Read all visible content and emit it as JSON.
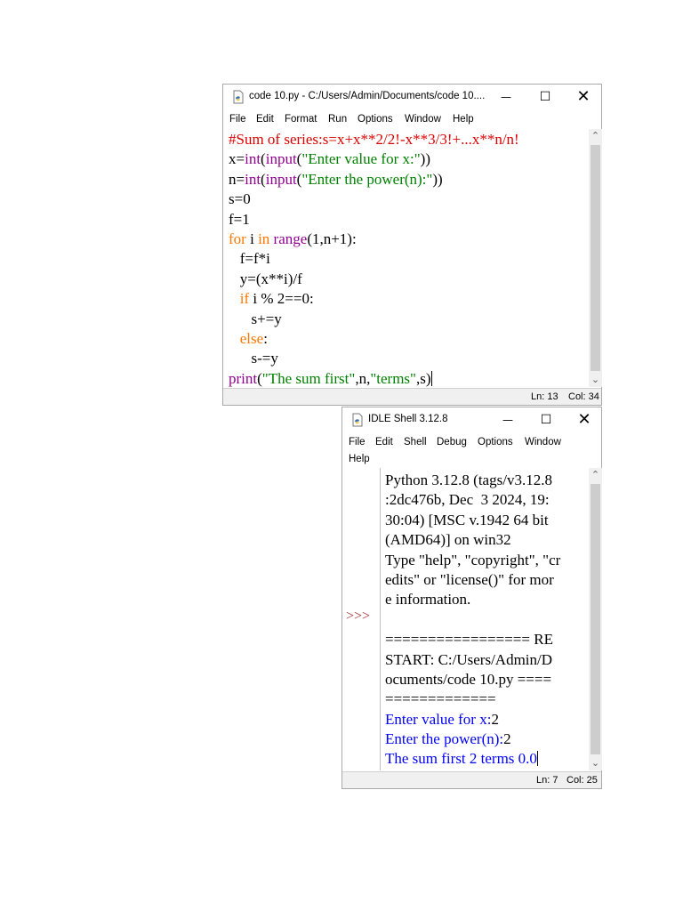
{
  "colors": {
    "comment": "#dd0000",
    "builtin": "#900090",
    "string": "#008000",
    "keyword": "#ff7700",
    "output": "#0000ff",
    "prompt": "#a52a2a"
  },
  "editor": {
    "title": "code 10.py - C:/Users/Admin/Documents/code 10....",
    "menu": [
      "File",
      "Edit",
      "Format",
      "Run",
      "Options",
      "Window",
      "Help"
    ],
    "code": [
      [
        [
          "comment",
          "#Sum of series:s=x+x**2/2!-x**3/3!+...x**n/n!"
        ]
      ],
      [
        [
          "default",
          "x="
        ],
        [
          "builtin",
          "int"
        ],
        [
          "default",
          "("
        ],
        [
          "builtin",
          "input"
        ],
        [
          "default",
          "("
        ],
        [
          "string",
          "\"Enter value for x:\""
        ],
        [
          "default",
          "))"
        ]
      ],
      [
        [
          "default",
          "n="
        ],
        [
          "builtin",
          "int"
        ],
        [
          "default",
          "("
        ],
        [
          "builtin",
          "input"
        ],
        [
          "default",
          "("
        ],
        [
          "string",
          "\"Enter the power(n):\""
        ],
        [
          "default",
          "))"
        ]
      ],
      [
        [
          "default",
          "s=0"
        ]
      ],
      [
        [
          "default",
          "f=1"
        ]
      ],
      [
        [
          "keyword",
          "for"
        ],
        [
          "default",
          " i "
        ],
        [
          "keyword",
          "in"
        ],
        [
          "default",
          " "
        ],
        [
          "builtin",
          "range"
        ],
        [
          "default",
          "(1,n+1):"
        ]
      ],
      [
        [
          "default",
          "   f=f*i"
        ]
      ],
      [
        [
          "default",
          "   y=(x**i)/f"
        ]
      ],
      [
        [
          "default",
          "   "
        ],
        [
          "keyword",
          "if"
        ],
        [
          "default",
          " i % 2==0:"
        ]
      ],
      [
        [
          "default",
          "      s+=y"
        ]
      ],
      [
        [
          "default",
          "   "
        ],
        [
          "keyword",
          "else"
        ],
        [
          "default",
          ":"
        ]
      ],
      [
        [
          "default",
          "      s-=y"
        ]
      ],
      [
        [
          "builtin",
          "print"
        ],
        [
          "default",
          "("
        ],
        [
          "string",
          "\"The sum first\""
        ],
        [
          "default",
          ",n,"
        ],
        [
          "string",
          "\"terms\""
        ],
        [
          "default",
          ",s)"
        ]
      ]
    ],
    "status": {
      "line": "Ln: 13",
      "col": "Col: 34"
    }
  },
  "shell": {
    "title": "IDLE Shell 3.12.8",
    "menu": [
      "File",
      "Edit",
      "Shell",
      "Debug",
      "Options",
      "Window",
      "Help"
    ],
    "prompt": ">>>",
    "lines": [
      [
        [
          "default",
          "Python 3.12.8 (tags/v3.12.8"
        ]
      ],
      [
        [
          "default",
          ":2dc476b, Dec  3 2024, 19:"
        ]
      ],
      [
        [
          "default",
          "30:04) [MSC v.1942 64 bit"
        ]
      ],
      [
        [
          "default",
          "(AMD64)] on win32"
        ]
      ],
      [
        [
          "default",
          "Type \"help\", \"copyright\", \"cr"
        ]
      ],
      [
        [
          "default",
          "edits\" or \"license()\" for mor"
        ]
      ],
      [
        [
          "default",
          "e information."
        ]
      ],
      [
        [
          "default",
          ""
        ]
      ],
      [
        [
          "default",
          "================= RE"
        ]
      ],
      [
        [
          "default",
          "START: C:/Users/Admin/D"
        ]
      ],
      [
        [
          "default",
          "ocuments/code 10.py ===="
        ]
      ],
      [
        [
          "default",
          "============="
        ]
      ],
      [
        [
          "output",
          "Enter value for x:"
        ],
        [
          "default",
          "2"
        ]
      ],
      [
        [
          "output",
          "Enter the power(n):"
        ],
        [
          "default",
          "2"
        ]
      ],
      [
        [
          "output",
          "The sum first 2 terms 0.0"
        ]
      ]
    ],
    "status": {
      "line": "Ln: 7",
      "col": "Col: 25"
    }
  },
  "icons": {
    "editor_title": "python-file-icon",
    "shell_title": "python-shell-icon",
    "minimize": "minimize-icon",
    "maximize": "maximize-icon",
    "close": "close-icon",
    "scroll_up": "scroll-up-arrow-icon",
    "scroll_down": "scroll-down-arrow-icon"
  }
}
